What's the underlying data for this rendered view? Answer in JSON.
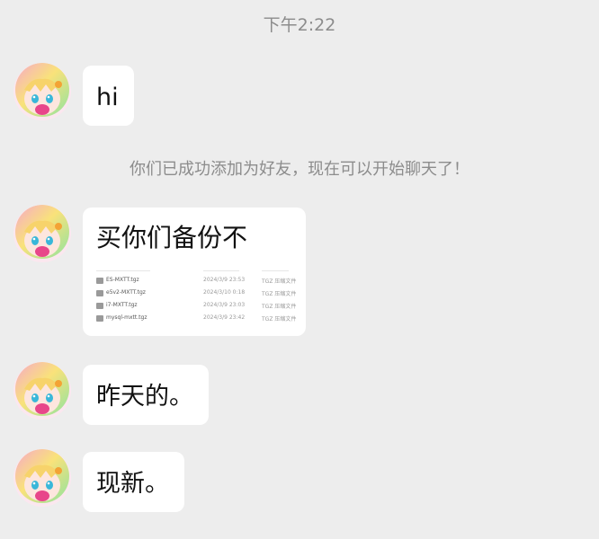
{
  "chat": {
    "timestamp": "下午2:22",
    "system_notice": "你们已成功添加为好友，现在可以开始聊天了！"
  },
  "messages": [
    {
      "sender": "contact",
      "text": "hi"
    },
    {
      "sender": "contact",
      "text": "买你们备份不",
      "attachment": {
        "files": [
          {
            "name": "ES-MXTT.tgz",
            "date": "2024/3/9 23:53",
            "type": "TGZ 压缩文件"
          },
          {
            "name": "e5v2-MXTT.tgz",
            "date": "2024/3/10 0:18",
            "type": "TGZ 压缩文件"
          },
          {
            "name": "i7-MXTT.tgz",
            "date": "2024/3/9 23:03",
            "type": "TGZ 压缩文件"
          },
          {
            "name": "mysql-mxtt.tgz",
            "date": "2024/3/9 23:42",
            "type": "TGZ 压缩文件"
          }
        ]
      }
    },
    {
      "sender": "contact",
      "text": "昨天的。"
    },
    {
      "sender": "contact",
      "text": "现新。"
    }
  ],
  "colors": {
    "background": "#ededed",
    "bubble": "#ffffff",
    "muted_text": "#8c8c8c"
  },
  "icons": {
    "avatar": "anime-avatar-icon",
    "file": "file-icon"
  }
}
